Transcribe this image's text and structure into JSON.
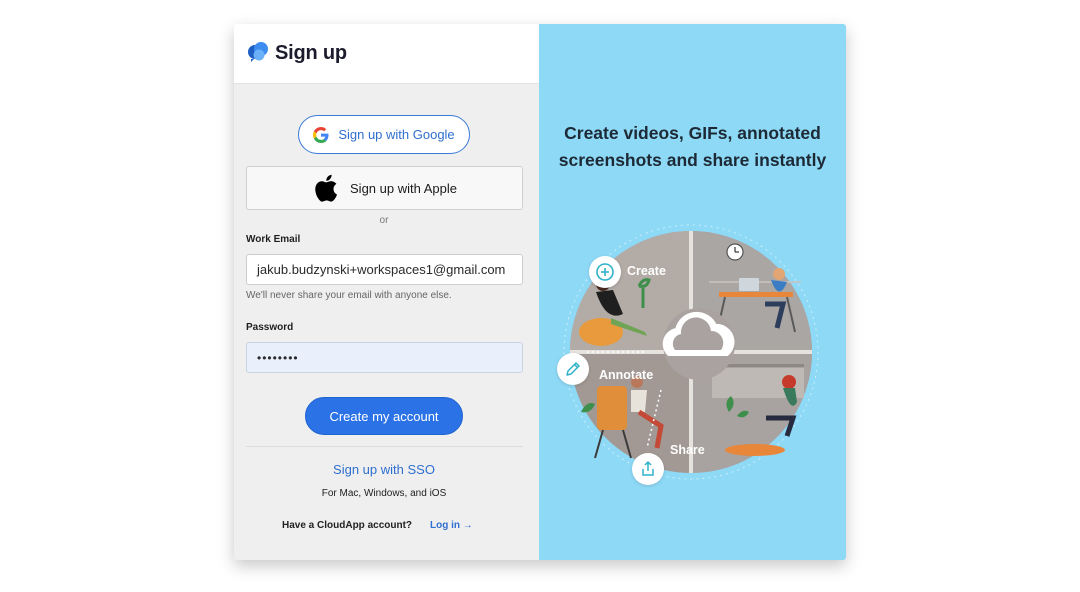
{
  "header": {
    "title": "Sign up",
    "logo_icon": "cloudapp-logo-icon"
  },
  "oauth": {
    "google_label": "Sign up with Google",
    "apple_label": "Sign up with Apple",
    "or_text": "or"
  },
  "form": {
    "email_label": "Work Email",
    "email_value": "jakub.budzynski+workspaces1@gmail.com",
    "email_hint": "We'll never share your email with anyone else.",
    "password_label": "Password",
    "password_value": "••••••••",
    "submit_label": "Create my account"
  },
  "footer": {
    "sso_label": "Sign up with SSO",
    "platforms_text": "For Mac, Windows, and iOS",
    "have_account_text": "Have a CloudApp account?",
    "login_label": "Log in"
  },
  "promo": {
    "headline_line1": "Create videos, GIFs, annotated",
    "headline_line2": "screenshots and share instantly",
    "label_create": "Create",
    "label_annotate": "Annotate",
    "label_share": "Share"
  },
  "colors": {
    "accent": "#2a72e6",
    "link": "#2f6fcf",
    "promo_bg": "#8ed9f6",
    "form_bg": "#efefef"
  }
}
